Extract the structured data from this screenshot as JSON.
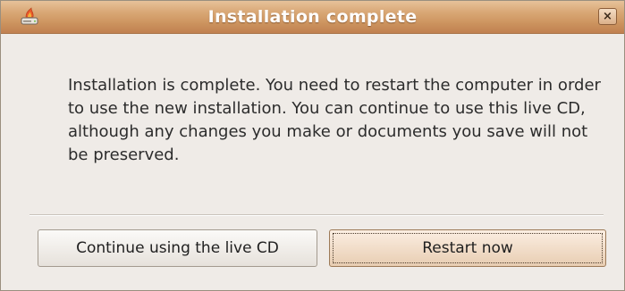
{
  "window": {
    "title": "Installation complete",
    "icon": "installer-icon",
    "close_label": "×"
  },
  "message": {
    "text": "Installation is complete. You need to restart the computer in order to use the new installation. You can continue to use this live CD, although any changes you make or documents you save will not be preserved."
  },
  "buttons": {
    "continue_label": "Continue using the live CD",
    "restart_label": "Restart now"
  },
  "colors": {
    "titlebar": "#cc935e",
    "window_background": "#efebe7",
    "default_button": "#e8cdb2"
  }
}
